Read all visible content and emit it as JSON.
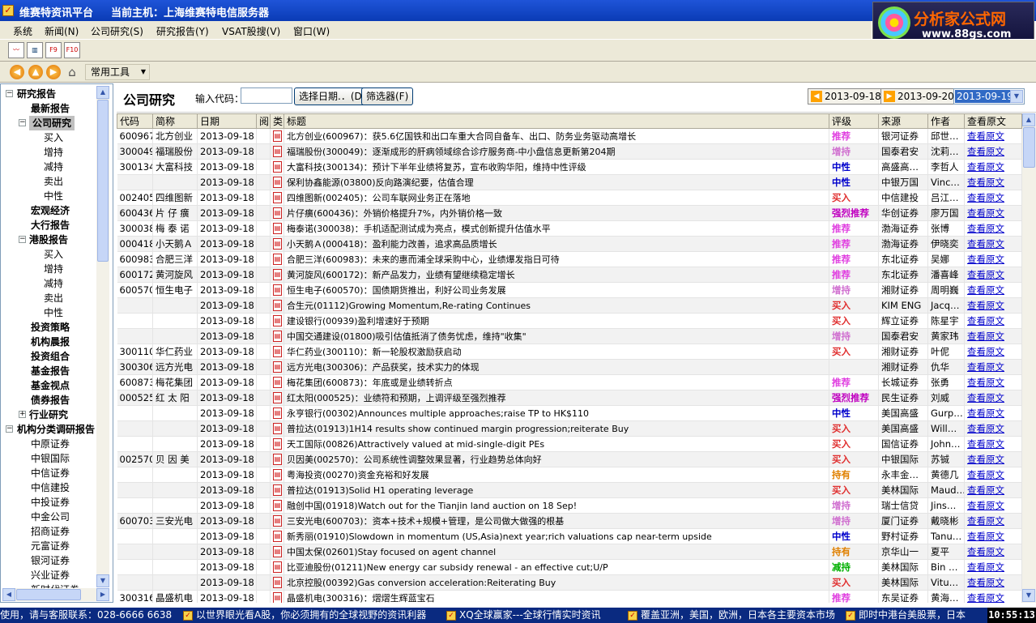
{
  "app": {
    "title": "维赛特资讯平台",
    "host": "当前主机：上海维赛特电信服务器"
  },
  "logo": {
    "text": "分析家公式网",
    "url": "www.88gs.com"
  },
  "menu": [
    "系统",
    "新闻(N)",
    "公司研究(S)",
    "研究报告(Y)",
    "VSAT股搜(V)",
    "窗口(W)"
  ],
  "toolbar": {
    "icons": [
      "chart-icon",
      "bar-chart-icon",
      "f9-icon",
      "f10-icon"
    ],
    "f9": "F9",
    "f10": "F10",
    "dropdown": "常用工具"
  },
  "tree": [
    {
      "label": "研究报告",
      "bold": true,
      "level": 0,
      "pm": "−"
    },
    {
      "label": "最新报告",
      "bold": true,
      "level": 1
    },
    {
      "label": "公司研究",
      "bold": true,
      "level": 1,
      "pm": "−",
      "selected": true
    },
    {
      "label": "买入",
      "level": 2
    },
    {
      "label": "增持",
      "level": 2
    },
    {
      "label": "减持",
      "level": 2
    },
    {
      "label": "卖出",
      "level": 2
    },
    {
      "label": "中性",
      "level": 2
    },
    {
      "label": "宏观经济",
      "bold": true,
      "level": 1
    },
    {
      "label": "大行报告",
      "bold": true,
      "level": 1
    },
    {
      "label": "港股报告",
      "bold": true,
      "level": 1,
      "pm": "−"
    },
    {
      "label": "买入",
      "level": 2
    },
    {
      "label": "增持",
      "level": 2
    },
    {
      "label": "减持",
      "level": 2
    },
    {
      "label": "卖出",
      "level": 2
    },
    {
      "label": "中性",
      "level": 2
    },
    {
      "label": "投资策略",
      "bold": true,
      "level": 1
    },
    {
      "label": "机构晨报",
      "bold": true,
      "level": 1
    },
    {
      "label": "投资组合",
      "bold": true,
      "level": 1
    },
    {
      "label": "基金报告",
      "bold": true,
      "level": 1
    },
    {
      "label": "基金视点",
      "bold": true,
      "level": 1
    },
    {
      "label": "债券报告",
      "bold": true,
      "level": 1
    },
    {
      "label": "行业研究",
      "bold": true,
      "level": 1,
      "pm": "+"
    },
    {
      "label": "机构分类调研报告",
      "bold": true,
      "level": 0,
      "pm": "−"
    },
    {
      "label": "中原证券",
      "level": 1
    },
    {
      "label": "中银国际",
      "level": 1
    },
    {
      "label": "中信证券",
      "level": 1
    },
    {
      "label": "中信建投",
      "level": 1
    },
    {
      "label": "中投证券",
      "level": 1
    },
    {
      "label": "中金公司",
      "level": 1
    },
    {
      "label": "招商证券",
      "level": 1
    },
    {
      "label": "元富证券",
      "level": 1
    },
    {
      "label": "银河证券",
      "level": 1
    },
    {
      "label": "兴业证券",
      "level": 1
    },
    {
      "label": "新时代证券",
      "level": 1
    }
  ],
  "panel": {
    "title": "公司研究",
    "code_label": "输入代码：",
    "date_btn": "选择日期.．(D)",
    "filter_btn": "筛选器(F)",
    "prev_date": "2013-09-18",
    "next_date": "2013-09-20",
    "cur_date": "2013-09-19"
  },
  "columns": [
    "代码",
    "简称",
    "日期",
    "阅",
    "类",
    "标题",
    "评级",
    "来源",
    "作者",
    "查看原文"
  ],
  "rating_colors": {
    "推荐": "#e040e0",
    "增持": "#d070d0",
    "中性": "#0000cc",
    "买入": "#e03030",
    "强烈推荐": "#c000c0",
    "持有": "#e08000",
    "减持": "#00b000"
  },
  "rows": [
    [
      "600967",
      "北方创业",
      "2013-09-18",
      "北方创业(600967)：获5.6亿国铁和出口车重大合同自备车、出口、防务业务驱动高增长",
      "推荐",
      "银河证券",
      "邱世…"
    ],
    [
      "300049",
      "福瑞股份",
      "2013-09-18",
      "福瑞股份(300049)：逐渐成形的肝病领域综合诊疗服务商-中小盘信息更新第204期",
      "增持",
      "国泰君安",
      "沈莉…"
    ],
    [
      "300134",
      "大富科技",
      "2013-09-18",
      "大富科技(300134)：预计下半年业绩将复苏，宣布收购华阳，维持中性评级",
      "中性",
      "高盛高…",
      "李哲人"
    ],
    [
      "",
      "",
      "2013-09-18",
      "保利协鑫能源(03800)反向路演纪要，估值合理",
      "中性",
      "中银万国",
      "Vinc…"
    ],
    [
      "002405",
      "四维图新",
      "2013-09-18",
      "四维图新(002405)：公司车联网业务正在落地",
      "买入",
      "中信建投",
      "吕江…"
    ],
    [
      "600436",
      "片 仔 癀",
      "2013-09-18",
      "片仔癀(600436)：外销价格提升7%，内外销价格一致",
      "强烈推荐",
      "华创证券",
      "廖万国"
    ],
    [
      "300038",
      "梅 泰 诺",
      "2013-09-18",
      "梅泰诺(300038)：手机适配测试成为亮点，模式创新提升估值水平",
      "推荐",
      "渤海证券",
      "张博"
    ],
    [
      "000418",
      "小天鹅Ａ",
      "2013-09-18",
      "小天鹅Ａ(000418)：盈利能力改善，追求高品质增长",
      "推荐",
      "渤海证券",
      "伊晓奕"
    ],
    [
      "600983",
      "合肥三洋",
      "2013-09-18",
      "合肥三洋(600983)：未来的惠而浦全球采购中心，业绩爆发指日可待",
      "推荐",
      "东北证券",
      "吴娜"
    ],
    [
      "600172",
      "黄河旋风",
      "2013-09-18",
      "黄河旋风(600172)：新产品发力，业绩有望继续稳定增长",
      "推荐",
      "东北证券",
      "潘喜峰"
    ],
    [
      "600570",
      "恒生电子",
      "2013-09-18",
      "恒生电子(600570)：国债期货推出，利好公司业务发展",
      "增持",
      "湘财证券",
      "周明巍"
    ],
    [
      "",
      "",
      "2013-09-18",
      "合生元(01112)Growing Momentum,Re-rating Continues",
      "买入",
      "KIM ENG",
      "Jacq…"
    ],
    [
      "",
      "",
      "2013-09-18",
      "建设银行(00939)盈利增速好于预期",
      "买入",
      "辉立证券",
      "陈星宇"
    ],
    [
      "",
      "",
      "2013-09-18",
      "中国交通建设(01800)吸引估值抵消了债务忧虑，维持\"收集\"",
      "增持",
      "国泰君安",
      "黄家玮"
    ],
    [
      "300110",
      "华仁药业",
      "2013-09-18",
      "华仁药业(300110)：新一轮股权激励获启动",
      "买入",
      "湘财证券",
      "叶伲"
    ],
    [
      "300306",
      "远方光电",
      "2013-09-18",
      "远方光电(300306)：产品获奖，技术实力的体现",
      "",
      "湘财证券",
      "仇华"
    ],
    [
      "600873",
      "梅花集团",
      "2013-09-18",
      "梅花集团(600873)：年底或是业绩转折点",
      "推荐",
      "长城证券",
      "张勇"
    ],
    [
      "000525",
      "红 太 阳",
      "2013-09-18",
      "红太阳(000525)：业绩符和预期，上调评级至强烈推荐",
      "强烈推荐",
      "民生证券",
      "刘威"
    ],
    [
      "",
      "",
      "2013-09-18",
      "永亨银行(00302)Announces multiple approaches;raise TP to HK$110",
      "中性",
      "美国高盛",
      "Gurp…"
    ],
    [
      "",
      "",
      "2013-09-18",
      "普拉达(01913)1H14 results show continued margin progression;reiterate Buy",
      "买入",
      "美国高盛",
      "Will…"
    ],
    [
      "",
      "",
      "2013-09-18",
      "天工国际(00826)Attractively valued at mid-single-digit PEs",
      "买入",
      "国信证券",
      "John…"
    ],
    [
      "002570",
      "贝 因 美",
      "2013-09-18",
      "贝因美(002570)：公司系统性调整效果显著，行业趋势总体向好",
      "买入",
      "中银国际",
      "苏铖"
    ],
    [
      "",
      "",
      "2013-09-18",
      "粤海投资(00270)资金充裕和好发展",
      "持有",
      "永丰金…",
      "黄德几"
    ],
    [
      "",
      "",
      "2013-09-18",
      "普拉达(01913)Solid H1 operating leverage",
      "买入",
      "美林国际",
      "Maud…"
    ],
    [
      "",
      "",
      "2013-09-18",
      "融创中国(01918)Watch out for the Tianjin land auction on 18 Sep!",
      "增持",
      "瑞士信贷",
      "Jins…"
    ],
    [
      "600703",
      "三安光电",
      "2013-09-18",
      "三安光电(600703)：资本+技术+规模+管理，是公司做大做强的根基",
      "增持",
      "厦门证券",
      "戴晓彬"
    ],
    [
      "",
      "",
      "2013-09-18",
      "新秀丽(01910)Slowdown in momentum (US,Asia)next year;rich valuations cap near-term upside",
      "中性",
      "野村证券",
      "Tanu…"
    ],
    [
      "",
      "",
      "2013-09-18",
      "中国太保(02601)Stay focused on agent channel",
      "持有",
      "京华山一",
      "夏平"
    ],
    [
      "",
      "",
      "2013-09-18",
      "比亚迪股份(01211)New energy car subsidy renewal - an effective cut;U/P",
      "减持",
      "美林国际",
      "Bin …"
    ],
    [
      "",
      "",
      "2013-09-18",
      "北京控股(00392)Gas conversion acceleration:Reiterating Buy",
      "买入",
      "美林国际",
      "Vitu…"
    ],
    [
      "300316",
      "晶盛机电",
      "2013-09-18",
      "晶盛机电(300316)：熠熠生辉蓝宝石",
      "推荐",
      "东吴证券",
      "黄海…"
    ]
  ],
  "view_link": "查看原文",
  "status": {
    "contact": "使用，请与客服联系：028-6666 6638",
    "t1": "以世界眼光看A股，你必须拥有的全球视野的资讯利器",
    "t2": "XQ全球赢家---全球行情实时资讯",
    "t3": "覆盖亚洲，美国，欧洲，日本各主要资本市场",
    "t4": "即时中港台美股票，日本",
    "clock": "10:55:13"
  }
}
